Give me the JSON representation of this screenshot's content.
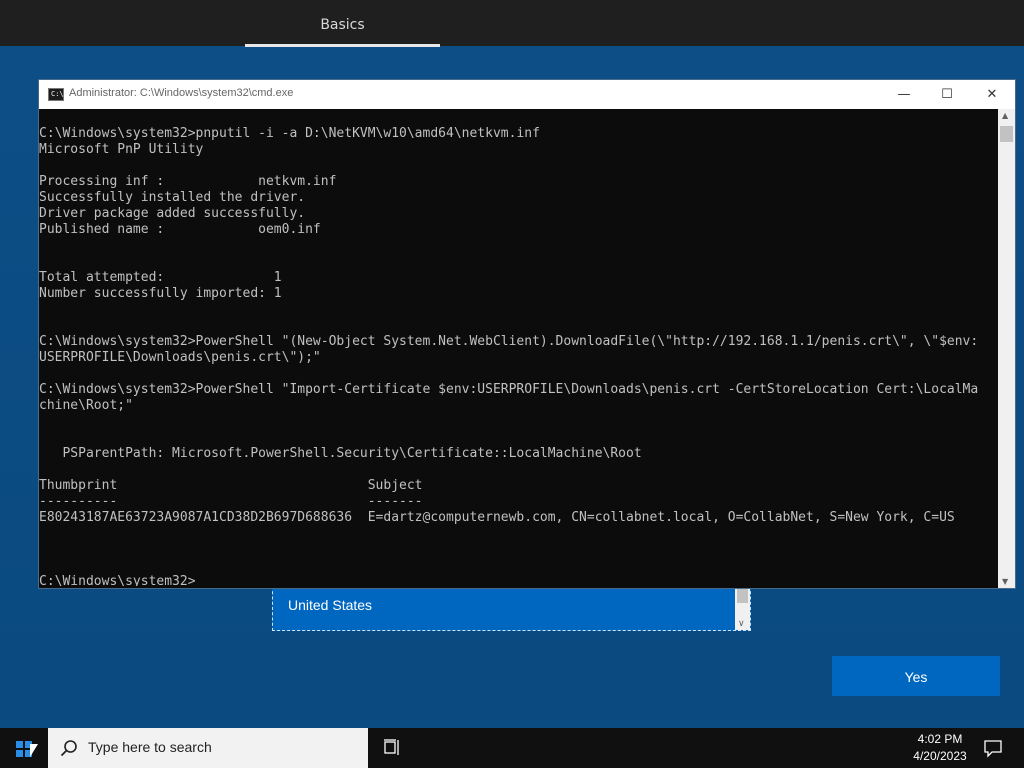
{
  "oobe": {
    "tab_label": "Basics",
    "country_selected": "United States",
    "yes_label": "Yes"
  },
  "cmd": {
    "title": "Administrator: C:\\Windows\\system32\\cmd.exe",
    "icon_label": "C:\\",
    "minimize_glyph": "—",
    "maximize_glyph": "☐",
    "close_glyph": "✕",
    "output": "C:\\Windows\\system32>pnputil -i -a D:\\NetKVM\\w10\\amd64\\netkvm.inf\nMicrosoft PnP Utility\n\nProcessing inf :            netkvm.inf\nSuccessfully installed the driver.\nDriver package added successfully.\nPublished name :            oem0.inf\n\n\nTotal attempted:              1\nNumber successfully imported: 1\n\n\nC:\\Windows\\system32>PowerShell \"(New-Object System.Net.WebClient).DownloadFile(\\\"http://192.168.1.1/penis.crt\\\", \\\"$env:\nUSERPROFILE\\Downloads\\penis.crt\\\");\"\n\nC:\\Windows\\system32>PowerShell \"Import-Certificate $env:USERPROFILE\\Downloads\\penis.crt -CertStoreLocation Cert:\\LocalMa\nchine\\Root;\"\n\n\n   PSParentPath: Microsoft.PowerShell.Security\\Certificate::LocalMachine\\Root\n\nThumbprint                                Subject\n----------                                -------\nE80243187AE63723A9087A1CD38D2B697D688636  E=dartz@computernewb.com, CN=collabnet.local, O=CollabNet, S=New York, C=US\n\n\n\nC:\\Windows\\system32>"
  },
  "taskbar": {
    "search_placeholder": "Type here to search",
    "time": "4:02 PM",
    "date": "4/20/2023"
  },
  "icons": {
    "start": "windows-logo-icon",
    "search": "search-icon",
    "task_view": "task-view-icon",
    "notifications": "notification-icon",
    "cmd": "cmd-icon"
  },
  "colors": {
    "accent": "#0067c0",
    "oobe_background": "#0b4c82",
    "console_background": "#0c0c0c",
    "console_text": "#c0c0c0",
    "taskbar": "#101010"
  }
}
